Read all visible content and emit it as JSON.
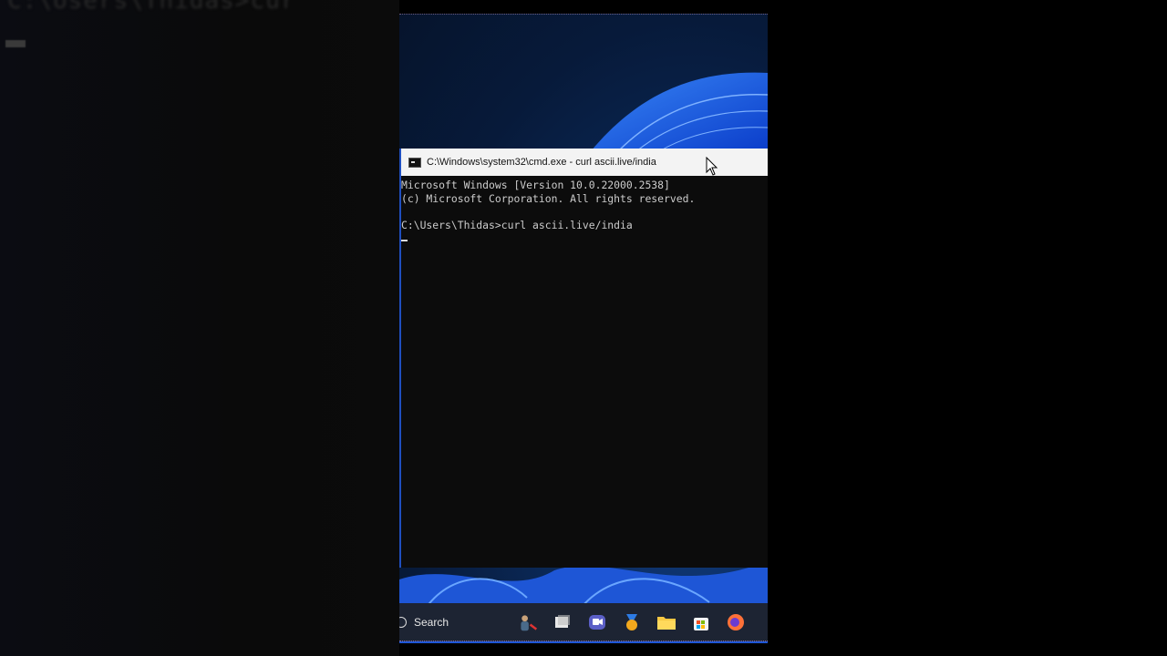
{
  "background": {
    "blurred_text": "C:\\Users\\Thidas>cur"
  },
  "window": {
    "title": "C:\\Windows\\system32\\cmd.exe - curl  ascii.live/india",
    "console_lines": [
      "Microsoft Windows [Version 10.0.22000.2538]",
      "(c) Microsoft Corporation. All rights reserved.",
      "",
      "C:\\Users\\Thidas>curl ascii.live/india"
    ]
  },
  "taskbar": {
    "search_label": "Search",
    "icons": [
      "widgets-icon",
      "task-view-icon",
      "chat-icon",
      "medal-app-icon",
      "file-explorer-icon",
      "store-icon",
      "firefox-icon"
    ]
  },
  "colors": {
    "console_bg": "#0c0c0c",
    "console_text": "#cccccc",
    "titlebar": "#f3f3f3",
    "taskbar": "#1d2433",
    "accent": "#1f4fbf"
  }
}
